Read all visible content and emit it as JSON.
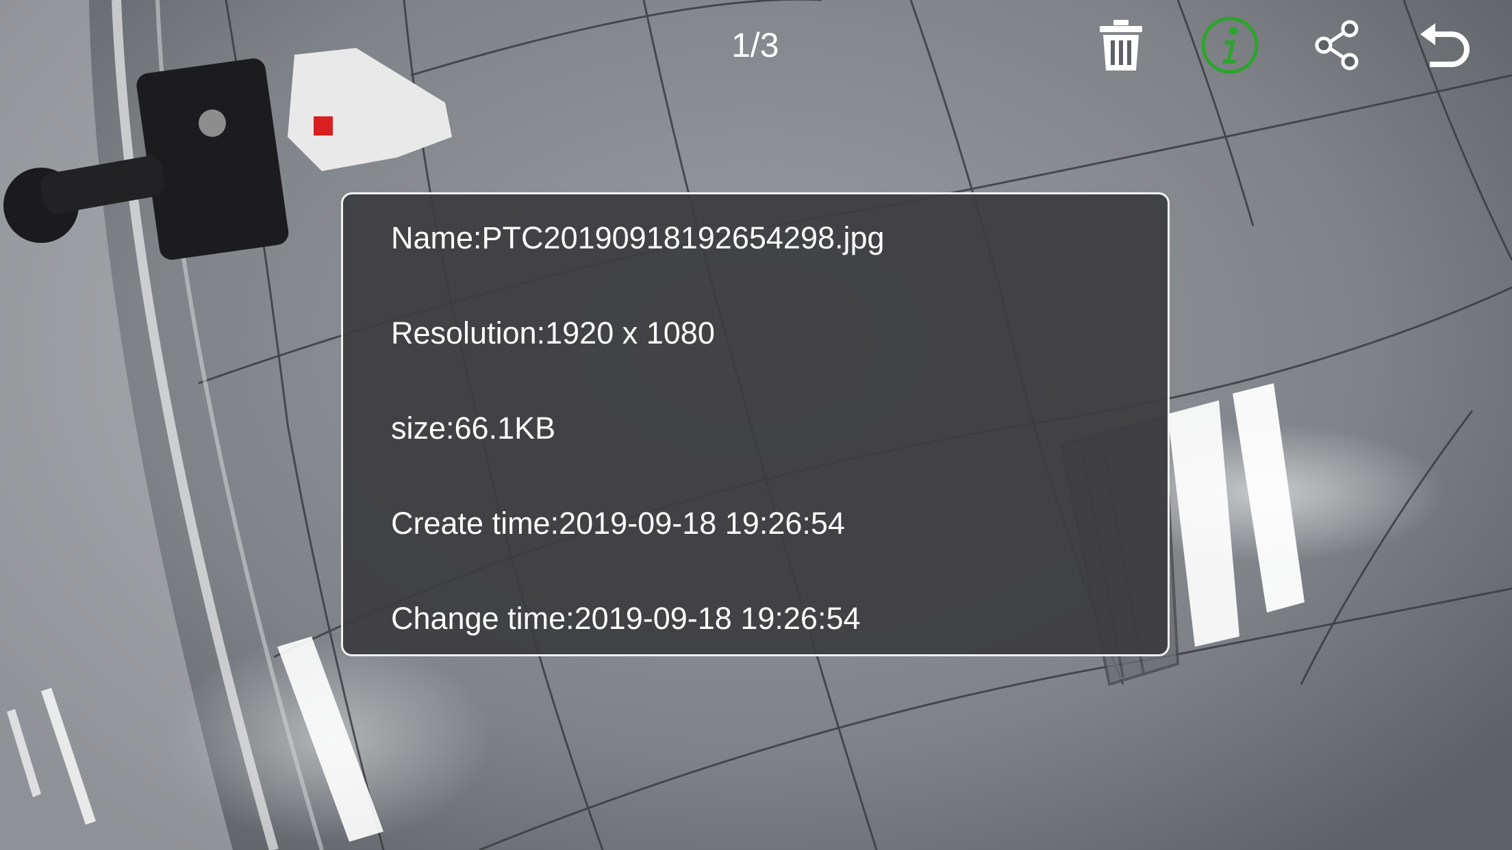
{
  "viewer": {
    "counter": "1/3"
  },
  "toolbar": {
    "delete_icon": "trash-icon",
    "info_icon": "info-icon",
    "share_icon": "share-icon",
    "back_icon": "back-arrow-icon",
    "info_active_color": "#2ca52c",
    "icon_color": "#ffffff"
  },
  "info": {
    "name": "Name:PTC20190918192654298.jpg",
    "resolution": "Resolution:1920 x 1080",
    "size": "size:66.1KB",
    "create_time": "Create time:2019-09-18 19:26:54",
    "change_time": "Change time:2019-09-18 19:26:54"
  }
}
